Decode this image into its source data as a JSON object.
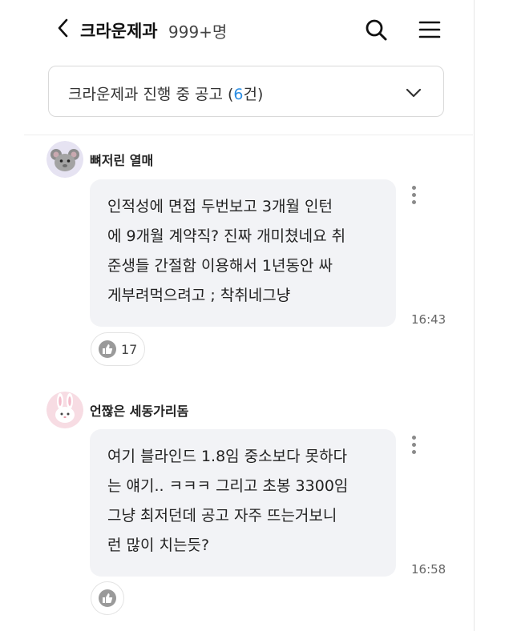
{
  "header": {
    "title": "크라운제과",
    "member_count": "999+명"
  },
  "filter": {
    "label_prefix": "크라운제과 진행 중 공고 (",
    "label_count": "6",
    "label_suffix": "건)"
  },
  "comments": [
    {
      "author": "뼈저린 열매",
      "avatar_icon": "mouse-avatar",
      "lines": [
        "인적성에 면접 두번보고 3개월 인턴",
        "에 9개월 계약직? 진짜 개미쳤네요 취",
        "준생들 간절함 이용해서 1년동안 싸",
        "게부려먹으려고 ; 착취네그냥"
      ],
      "time": "16:43",
      "likes": "17"
    },
    {
      "author": "언짢은 세동가리돔",
      "avatar_icon": "rabbit-avatar",
      "lines": [
        "여기 블라인드 1.8임 중소보다 못하다",
        "는 얘기.. ㅋㅋㅋ 그리고 초봉 3300임",
        "그냥 최저던데 공고 자주 뜨는거보니",
        "런 많이 치는듯?"
      ],
      "time": "16:58",
      "likes": ""
    }
  ],
  "colors": {
    "accent_count": "#2a8de3",
    "bubble_bg": "#f2f3f6"
  }
}
